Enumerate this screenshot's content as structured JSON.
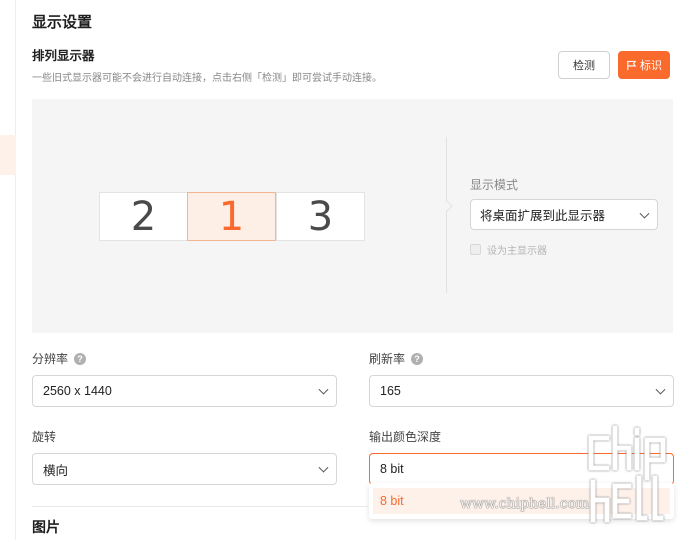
{
  "header": {
    "title": "显示设置"
  },
  "arrange": {
    "title": "排列显示器",
    "description": "一些旧式显示器可能不会进行自动连接，点击右侧「检测」即可尝试手动连接。",
    "detect_label": "检测",
    "identify_label": "标识",
    "monitors": [
      {
        "number": "2",
        "active": false
      },
      {
        "number": "1",
        "active": true
      },
      {
        "number": "3",
        "active": false
      }
    ],
    "display_mode": {
      "label": "显示模式",
      "value": "将桌面扩展到此显示器",
      "primary_label": "设为主显示器",
      "primary_checked": false
    }
  },
  "resolution": {
    "label": "分辨率",
    "value": "2560 x 1440"
  },
  "refresh_rate": {
    "label": "刷新率",
    "value": "165"
  },
  "rotation": {
    "label": "旋转",
    "value": "横向"
  },
  "color_depth": {
    "label": "输出颜色深度",
    "value": "8 bit",
    "options": [
      "8 bit"
    ]
  },
  "next_section": {
    "title": "图片"
  },
  "watermark": {
    "text": "www.chiphell.com",
    "logo": "chiphell-logo"
  },
  "colors": {
    "accent": "#fa6a2c",
    "accent_light": "#fdeee6",
    "panel_bg": "#f5f5f6"
  }
}
